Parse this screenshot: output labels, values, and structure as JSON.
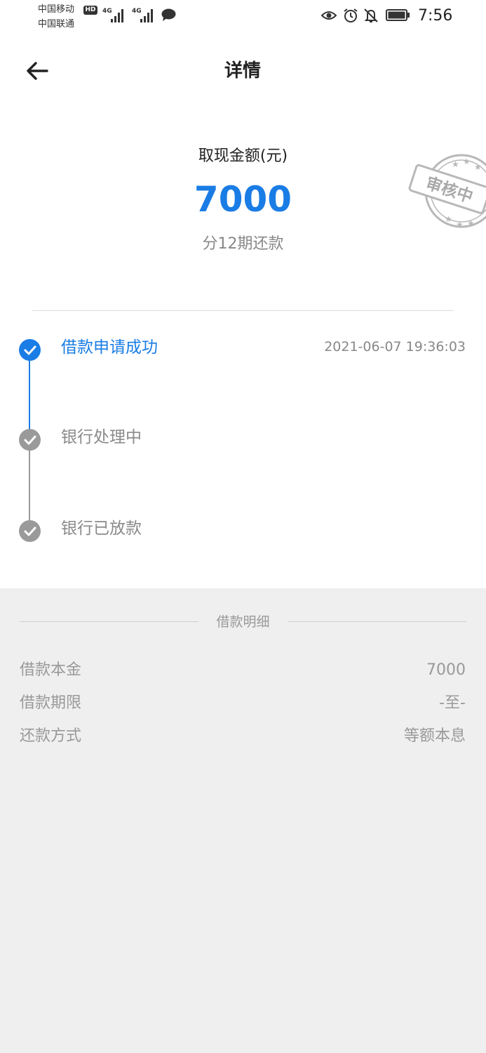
{
  "status_bar": {
    "carrier1": "中国移动",
    "hd": "HD",
    "carrier2": "中国联通",
    "net1": "4G",
    "net2": "4G",
    "time": "7:56"
  },
  "header": {
    "title": "详情"
  },
  "amount": {
    "label": "取现金额(元)",
    "value": "7000",
    "installments": "分12期还款",
    "stamp_text": "审核中"
  },
  "timeline": [
    {
      "label": "借款申请成功",
      "time": "2021-06-07 19:36:03",
      "done": true
    },
    {
      "label": "银行处理中",
      "time": "",
      "done": false
    },
    {
      "label": "银行已放款",
      "time": "",
      "done": false
    }
  ],
  "details": {
    "title": "借款明细",
    "rows": [
      {
        "label": "借款本金",
        "value": "7000"
      },
      {
        "label": "借款期限",
        "value": "-至-"
      },
      {
        "label": "还款方式",
        "value": "等额本息"
      }
    ]
  },
  "colors": {
    "accent": "#1a7de5",
    "inactive": "#9a9a9a",
    "panel": "#efefef"
  }
}
